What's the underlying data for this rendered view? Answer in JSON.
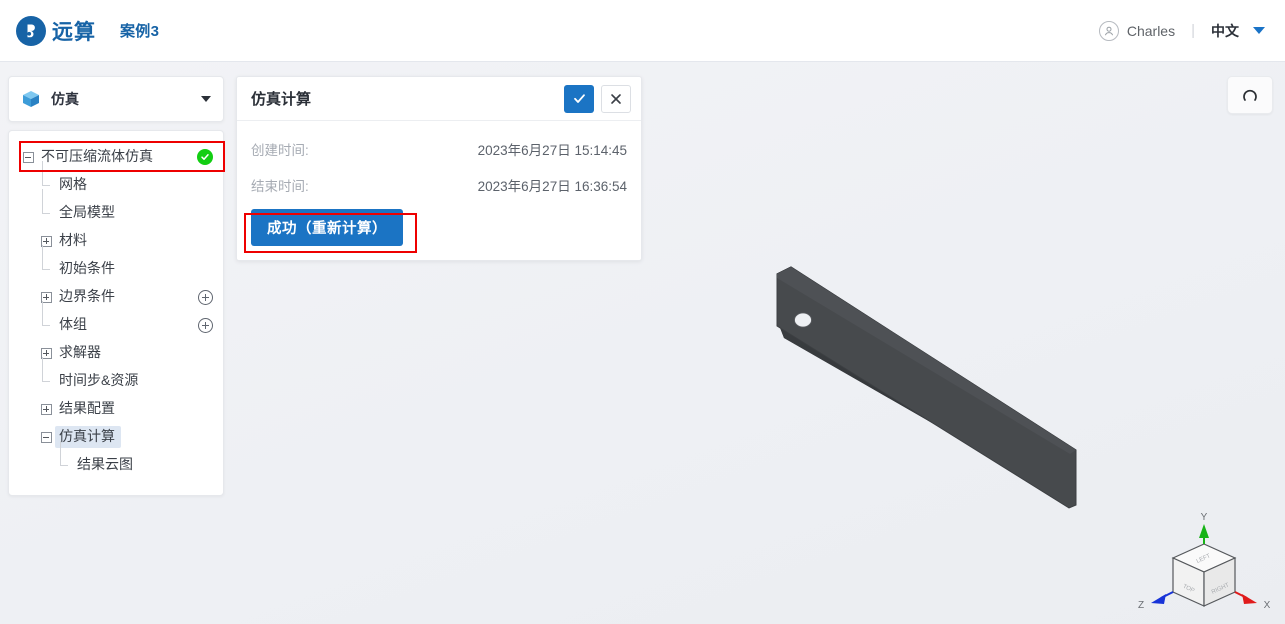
{
  "header": {
    "brand_name": "远算",
    "case_title": "案例3",
    "user_name": "Charles",
    "separator": "|",
    "language": "中文",
    "logo_icon": "logo-circle-b-icon",
    "avatar_icon": "user-avatar-icon",
    "caret_icon": "chevron-down-icon"
  },
  "sidebar": {
    "panel_icon": "blue-cube-icon",
    "panel_label": "仿真",
    "collapse_icon": "chevron-down-icon",
    "tree": [
      {
        "label": "不可压缩流体仿真",
        "depth": 1,
        "toggle": "minus",
        "status": "success",
        "selected": false,
        "highlighted": true
      },
      {
        "label": "网格",
        "depth": 2,
        "toggle": "leaf",
        "status": "",
        "selected": false
      },
      {
        "label": "全局模型",
        "depth": 2,
        "toggle": "leaf",
        "status": "",
        "selected": false
      },
      {
        "label": "材料",
        "depth": 2,
        "toggle": "plus",
        "status": "",
        "selected": false
      },
      {
        "label": "初始条件",
        "depth": 2,
        "toggle": "leaf",
        "status": "",
        "selected": false
      },
      {
        "label": "边界条件",
        "depth": 2,
        "toggle": "plus",
        "status": "",
        "selected": false,
        "add": true
      },
      {
        "label": "体组",
        "depth": 2,
        "toggle": "leaf",
        "status": "",
        "selected": false,
        "add": true
      },
      {
        "label": "求解器",
        "depth": 2,
        "toggle": "plus",
        "status": "",
        "selected": false
      },
      {
        "label": "时间步&资源",
        "depth": 2,
        "toggle": "leaf",
        "status": "",
        "selected": false
      },
      {
        "label": "结果配置",
        "depth": 2,
        "toggle": "plus",
        "status": "",
        "selected": false
      },
      {
        "label": "仿真计算",
        "depth": 2,
        "toggle": "minus",
        "status": "",
        "selected": true
      },
      {
        "label": "结果云图",
        "depth": 3,
        "toggle": "leaf",
        "status": "",
        "selected": false
      }
    ]
  },
  "panel": {
    "title": "仿真计算",
    "confirm_icon": "check-icon",
    "cancel_icon": "close-icon",
    "rows": [
      {
        "key": "创建时间:",
        "value": "2023年6月27日 15:14:45"
      },
      {
        "key": "结束时间:",
        "value": "2023年6月27日 16:36:54"
      }
    ],
    "run_button_label": "成功（重新计算）"
  },
  "viewport": {
    "reset_icon": "rotate-reset-icon",
    "model_name": "flat-plate-with-hole",
    "axis_widget": {
      "x_label": "X",
      "y_label": "Y",
      "z_label": "Z",
      "face_top": "TOP",
      "face_left": "LEFT",
      "face_right": "RIGHT"
    }
  },
  "annotations": [
    {
      "name": "redbox-tree-root",
      "target": "不可压缩流体仿真"
    },
    {
      "name": "redbox-run",
      "target": "成功（重新计算）"
    }
  ],
  "colors": {
    "brand_blue": "#1763a6",
    "accent_blue": "#1b74c4",
    "success_green": "#13ce13",
    "annotation_red": "#ee0000",
    "selected_row": "#dde6f2",
    "model_gray": "#474a4d"
  }
}
